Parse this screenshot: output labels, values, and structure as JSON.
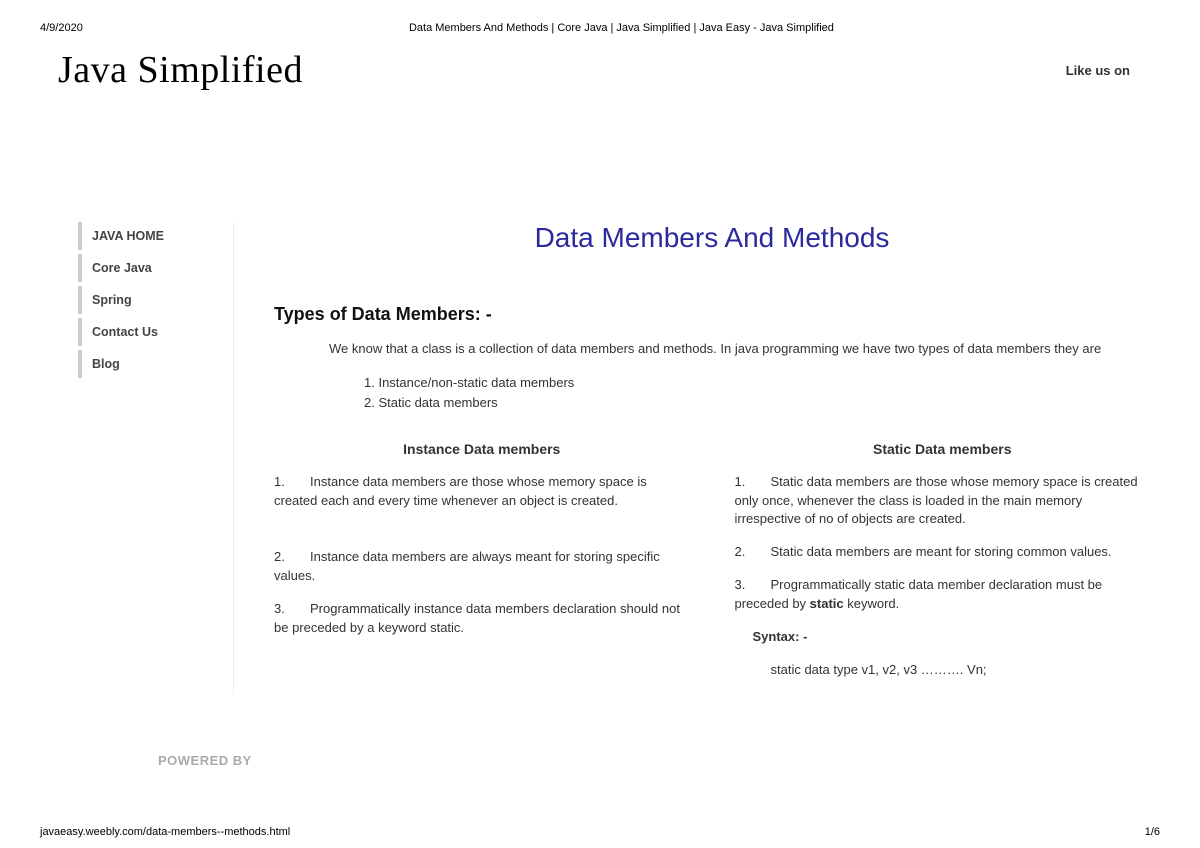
{
  "print": {
    "date": "4/9/2020",
    "title": "Data Members And Methods | Core Java | Java Simplified | Java Easy - Java Simplified",
    "url": "javaeasy.weebly.com/data-members--methods.html",
    "page": "1/6"
  },
  "header": {
    "logo": "Java Simplified",
    "like": "Like us on"
  },
  "nav": {
    "items": [
      "JAVA HOME",
      "Core Java",
      "Spring",
      "Contact Us",
      "Blog"
    ]
  },
  "article": {
    "title": "Data Members And Methods",
    "section_heading": "Types of Data Members: -",
    "intro": "We know that a class is a collection of data members and methods. In java programming we have two types of data members they are",
    "type_list": {
      "i1": "1. Instance/non-static data members",
      "i2": "2. Static data members"
    },
    "left": {
      "heading": "Instance Data members",
      "p1": "Instance data members are those whose memory space is created each and every time whenever an object is created.",
      "p2": "Instance data members are always meant for storing specific values.",
      "p3": "Programmatically instance data members declaration should not be preceded by a keyword static."
    },
    "right": {
      "heading": "Static Data members",
      "p1": "Static data members are those whose memory space is created only once, whenever the class is loaded in the main memory irrespective of no of objects are created.",
      "p2": "Static data members are meant for storing common values.",
      "p3_pre": "Programmatically static data member declaration must be preceded by ",
      "p3_bold": "static",
      "p3_post": " keyword.",
      "syntax_label": "Syntax: -",
      "syntax_line": "static data type v1, v2, v3 ………. Vn;"
    }
  },
  "footer": {
    "powered": "POWERED BY"
  }
}
